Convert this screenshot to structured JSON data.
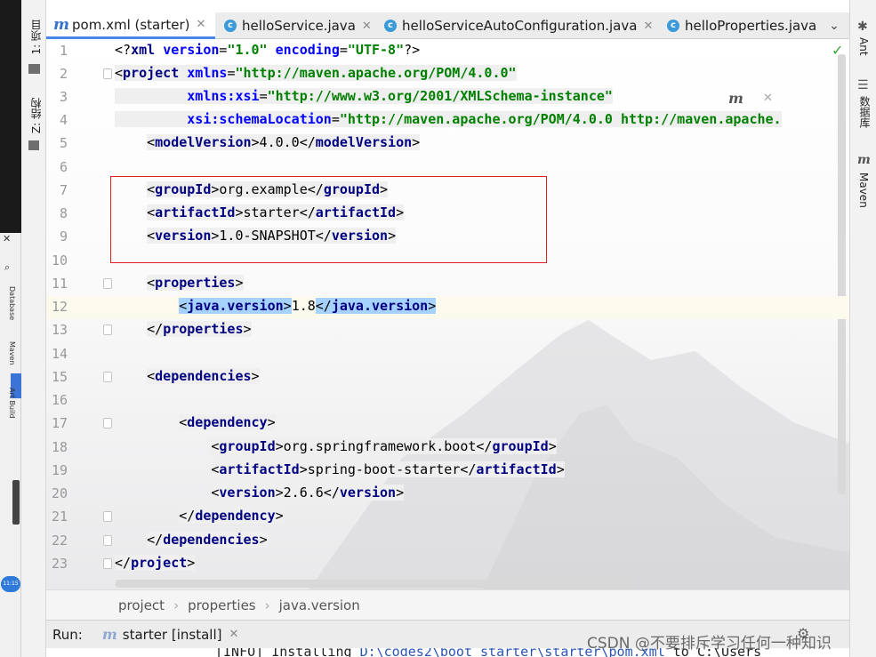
{
  "tabs": [
    {
      "label": "pom.xml (starter)",
      "icon": "maven-icon",
      "active": true
    },
    {
      "label": "helloService.java",
      "icon": "class-icon",
      "active": false
    },
    {
      "label": "helloServiceAutoConfiguration.java",
      "icon": "class-icon",
      "active": false
    },
    {
      "label": "helloProperties.java",
      "icon": "class-icon",
      "active": false
    }
  ],
  "left_tools": {
    "project": "1: 项目",
    "structure": "Z: 结构"
  },
  "right_tools": {
    "ant": "Ant",
    "database": "数据库",
    "maven": "Maven"
  },
  "left_strip": {
    "database": "Database",
    "maven": "Maven",
    "art_build": "Art Build",
    "clock": "11:15"
  },
  "editor": {
    "line_numbers": [
      "1",
      "2",
      "3",
      "4",
      "5",
      "6",
      "7",
      "8",
      "9",
      "10",
      "11",
      "12",
      "13",
      "14",
      "15",
      "16",
      "17",
      "18",
      "19",
      "20",
      "21",
      "22",
      "23"
    ],
    "current_line": 12,
    "highlighted_lines": [
      7,
      8,
      9
    ]
  },
  "breadcrumb": [
    "project",
    "properties",
    "java.version"
  ],
  "run": {
    "label": "Run:",
    "tab": "starter [install]",
    "output_prefix": "[INFO] Installing ",
    "output_link": "D:\\codes2\\boot_starter\\starter\\pom.xml",
    "output_suffix": " to C:\\Users"
  },
  "watermark": "CSDN @不要排斥学习任何一种知识"
}
